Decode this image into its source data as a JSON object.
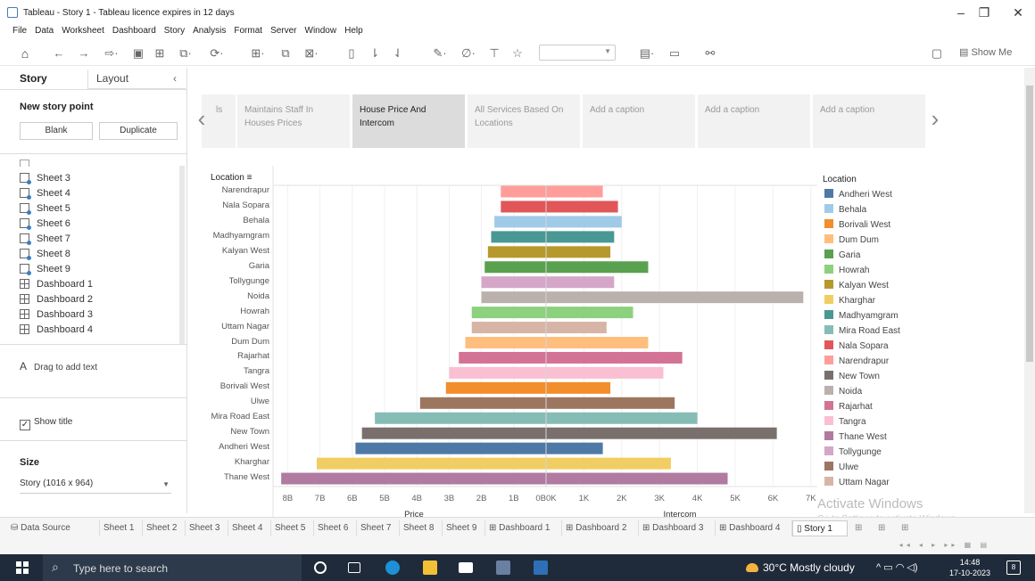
{
  "window": {
    "title": "Tableau - Story 1 - Tableau licence expires in 12 days"
  },
  "menu": [
    "File",
    "Data",
    "Worksheet",
    "Dashboard",
    "Story",
    "Analysis",
    "Format",
    "Server",
    "Window",
    "Help"
  ],
  "toolbar": {
    "show_me": "Show Me"
  },
  "left_panel": {
    "tabs": {
      "story": "Story",
      "layout": "Layout"
    },
    "new_story_point": "New story point",
    "blank": "Blank",
    "duplicate": "Duplicate",
    "sheets": [
      {
        "label": "Sheet 3",
        "kind": "sheet"
      },
      {
        "label": "Sheet 4",
        "kind": "sheet"
      },
      {
        "label": "Sheet 5",
        "kind": "sheet"
      },
      {
        "label": "Sheet 6",
        "kind": "sheet"
      },
      {
        "label": "Sheet 7",
        "kind": "sheet"
      },
      {
        "label": "Sheet 8",
        "kind": "sheet"
      },
      {
        "label": "Sheet 9",
        "kind": "sheet"
      },
      {
        "label": "Dashboard 1",
        "kind": "dashboard"
      },
      {
        "label": "Dashboard 2",
        "kind": "dashboard"
      },
      {
        "label": "Dashboard 3",
        "kind": "dashboard"
      },
      {
        "label": "Dashboard 4",
        "kind": "dashboard"
      }
    ],
    "drag_text": "Drag to add text",
    "show_title": "Show title",
    "size_label": "Size",
    "size_value": "Story (1016 x 964)"
  },
  "story_nav": {
    "captions": [
      {
        "text": "Maintains Staff In Houses Prices",
        "active": false
      },
      {
        "text": "House Price And Intercom",
        "active": true
      },
      {
        "text": "All Services Based On Locations",
        "active": false
      },
      {
        "text": "Add a caption",
        "active": false
      },
      {
        "text": "Add a caption",
        "active": false
      },
      {
        "text": "Add a caption",
        "active": false
      }
    ],
    "prev_partial": "ls"
  },
  "chart_data": {
    "type": "bar",
    "row_header": "Location",
    "x_axis_left_ticks": [
      "8B",
      "7B",
      "6B",
      "5B",
      "4B",
      "3B",
      "2B",
      "1B",
      "0B"
    ],
    "x_axis_right_ticks": [
      "0K",
      "1K",
      "2K",
      "3K",
      "4K",
      "5K",
      "6K",
      "7K"
    ],
    "left_measure_label": "Price",
    "right_measure_label": "Intercom",
    "rows": [
      {
        "location": "Narendrapur",
        "price_b": 1.4,
        "intercom_k": 1.5,
        "color": "#FF9D9A"
      },
      {
        "location": "Nala Sopara",
        "price_b": 1.4,
        "intercom_k": 1.9,
        "color": "#E15759"
      },
      {
        "location": "Behala",
        "price_b": 1.6,
        "intercom_k": 2.0,
        "color": "#A0CBE8"
      },
      {
        "location": "Madhyamgram",
        "price_b": 1.7,
        "intercom_k": 1.8,
        "color": "#499894"
      },
      {
        "location": "Kalyan West",
        "price_b": 1.8,
        "intercom_k": 1.7,
        "color": "#B6992D"
      },
      {
        "location": "Garia",
        "price_b": 1.9,
        "intercom_k": 2.7,
        "color": "#59A14F"
      },
      {
        "location": "Tollygunge",
        "price_b": 2.0,
        "intercom_k": 1.8,
        "color": "#D4A6C8"
      },
      {
        "location": "Noida",
        "price_b": 2.0,
        "intercom_k": 6.8,
        "color": "#BAB0AC"
      },
      {
        "location": "Howrah",
        "price_b": 2.3,
        "intercom_k": 2.3,
        "color": "#8CD17D"
      },
      {
        "location": "Uttam Nagar",
        "price_b": 2.3,
        "intercom_k": 1.6,
        "color": "#D7B5A6"
      },
      {
        "location": "Dum Dum",
        "price_b": 2.5,
        "intercom_k": 2.7,
        "color": "#FFBE7D"
      },
      {
        "location": "Rajarhat",
        "price_b": 2.7,
        "intercom_k": 3.6,
        "color": "#D37295"
      },
      {
        "location": "Tangra",
        "price_b": 3.0,
        "intercom_k": 3.1,
        "color": "#FABFD2"
      },
      {
        "location": "Borivali West",
        "price_b": 3.1,
        "intercom_k": 1.7,
        "color": "#F28E2B"
      },
      {
        "location": "Ulwe",
        "price_b": 3.9,
        "intercom_k": 3.4,
        "color": "#9D7660"
      },
      {
        "location": "Mira Road East",
        "price_b": 5.3,
        "intercom_k": 4.0,
        "color": "#86BCB6"
      },
      {
        "location": "New Town",
        "price_b": 5.7,
        "intercom_k": 6.1,
        "color": "#79706E"
      },
      {
        "location": "Andheri West",
        "price_b": 5.9,
        "intercom_k": 1.5,
        "color": "#4E79A7"
      },
      {
        "location": "Kharghar",
        "price_b": 7.1,
        "intercom_k": 3.3,
        "color": "#F1CE63"
      },
      {
        "location": "Thane West",
        "price_b": 8.2,
        "intercom_k": 4.8,
        "color": "#B07AA1"
      }
    ],
    "legend_title": "Location",
    "legend": [
      {
        "label": "Andheri West",
        "color": "#4E79A7"
      },
      {
        "label": "Behala",
        "color": "#A0CBE8"
      },
      {
        "label": "Borivali West",
        "color": "#F28E2B"
      },
      {
        "label": "Dum Dum",
        "color": "#FFBE7D"
      },
      {
        "label": "Garia",
        "color": "#59A14F"
      },
      {
        "label": "Howrah",
        "color": "#8CD17D"
      },
      {
        "label": "Kalyan West",
        "color": "#B6992D"
      },
      {
        "label": "Kharghar",
        "color": "#F1CE63"
      },
      {
        "label": "Madhyamgram",
        "color": "#499894"
      },
      {
        "label": "Mira Road East",
        "color": "#86BCB6"
      },
      {
        "label": "Nala Sopara",
        "color": "#E15759"
      },
      {
        "label": "Narendrapur",
        "color": "#FF9D9A"
      },
      {
        "label": "New Town",
        "color": "#79706E"
      },
      {
        "label": "Noida",
        "color": "#BAB0AC"
      },
      {
        "label": "Rajarhat",
        "color": "#D37295"
      },
      {
        "label": "Tangra",
        "color": "#FABFD2"
      },
      {
        "label": "Thane West",
        "color": "#B07AA1"
      },
      {
        "label": "Tollygunge",
        "color": "#D4A6C8"
      },
      {
        "label": "Ulwe",
        "color": "#9D7660"
      },
      {
        "label": "Uttam Nagar",
        "color": "#D7B5A6"
      }
    ]
  },
  "watermark": {
    "line1": "Activate Windows",
    "line2": "Go to Settings to activate Windows."
  },
  "bottom_tabs": [
    {
      "label": "Data Source",
      "kind": "datasource",
      "active": false
    },
    {
      "label": "Sheet 1",
      "kind": "sheet",
      "active": false
    },
    {
      "label": "Sheet 2",
      "kind": "sheet",
      "active": false
    },
    {
      "label": "Sheet 3",
      "kind": "sheet",
      "active": false
    },
    {
      "label": "Sheet 4",
      "kind": "sheet",
      "active": false
    },
    {
      "label": "Sheet 5",
      "kind": "sheet",
      "active": false
    },
    {
      "label": "Sheet 6",
      "kind": "sheet",
      "active": false
    },
    {
      "label": "Sheet 7",
      "kind": "sheet",
      "active": false
    },
    {
      "label": "Sheet 8",
      "kind": "sheet",
      "active": false
    },
    {
      "label": "Sheet 9",
      "kind": "sheet",
      "active": false
    },
    {
      "label": "Dashboard 1",
      "kind": "dashboard",
      "active": false
    },
    {
      "label": "Dashboard 2",
      "kind": "dashboard",
      "active": false
    },
    {
      "label": "Dashboard 3",
      "kind": "dashboard",
      "active": false
    },
    {
      "label": "Dashboard 4",
      "kind": "dashboard",
      "active": false
    },
    {
      "label": "Story 1",
      "kind": "story",
      "active": true
    }
  ],
  "taskbar": {
    "search_placeholder": "Type here to search",
    "weather": "30°C  Mostly cloudy",
    "time": "14:48",
    "date": "17-10-2023",
    "notifications": "8"
  }
}
